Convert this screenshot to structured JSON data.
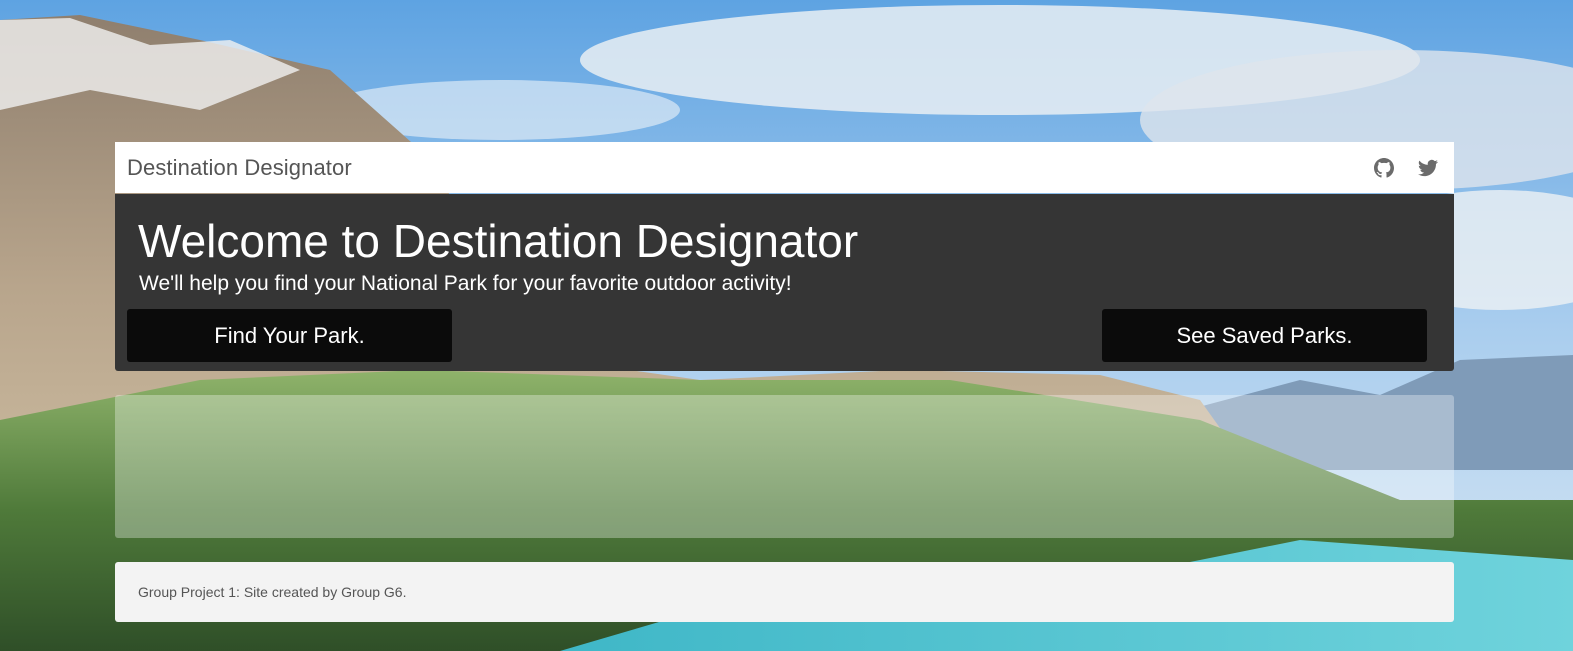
{
  "navbar": {
    "brand": "Destination Designator",
    "icons": [
      "github-icon",
      "twitter-icon"
    ]
  },
  "hero": {
    "title": "Welcome to Destination Designator",
    "subtitle": "We'll help you find your National Park for your favorite outdoor activity!",
    "find_button": "Find Your Park.",
    "saved_button": "See Saved Parks."
  },
  "footer": {
    "text": "Group Project 1: Site created by Group G6."
  },
  "colors": {
    "hero_bg": "#353535",
    "button_bg": "#0b0b0b",
    "navbar_bg": "#ffffff",
    "footer_bg": "#f3f3f3"
  }
}
